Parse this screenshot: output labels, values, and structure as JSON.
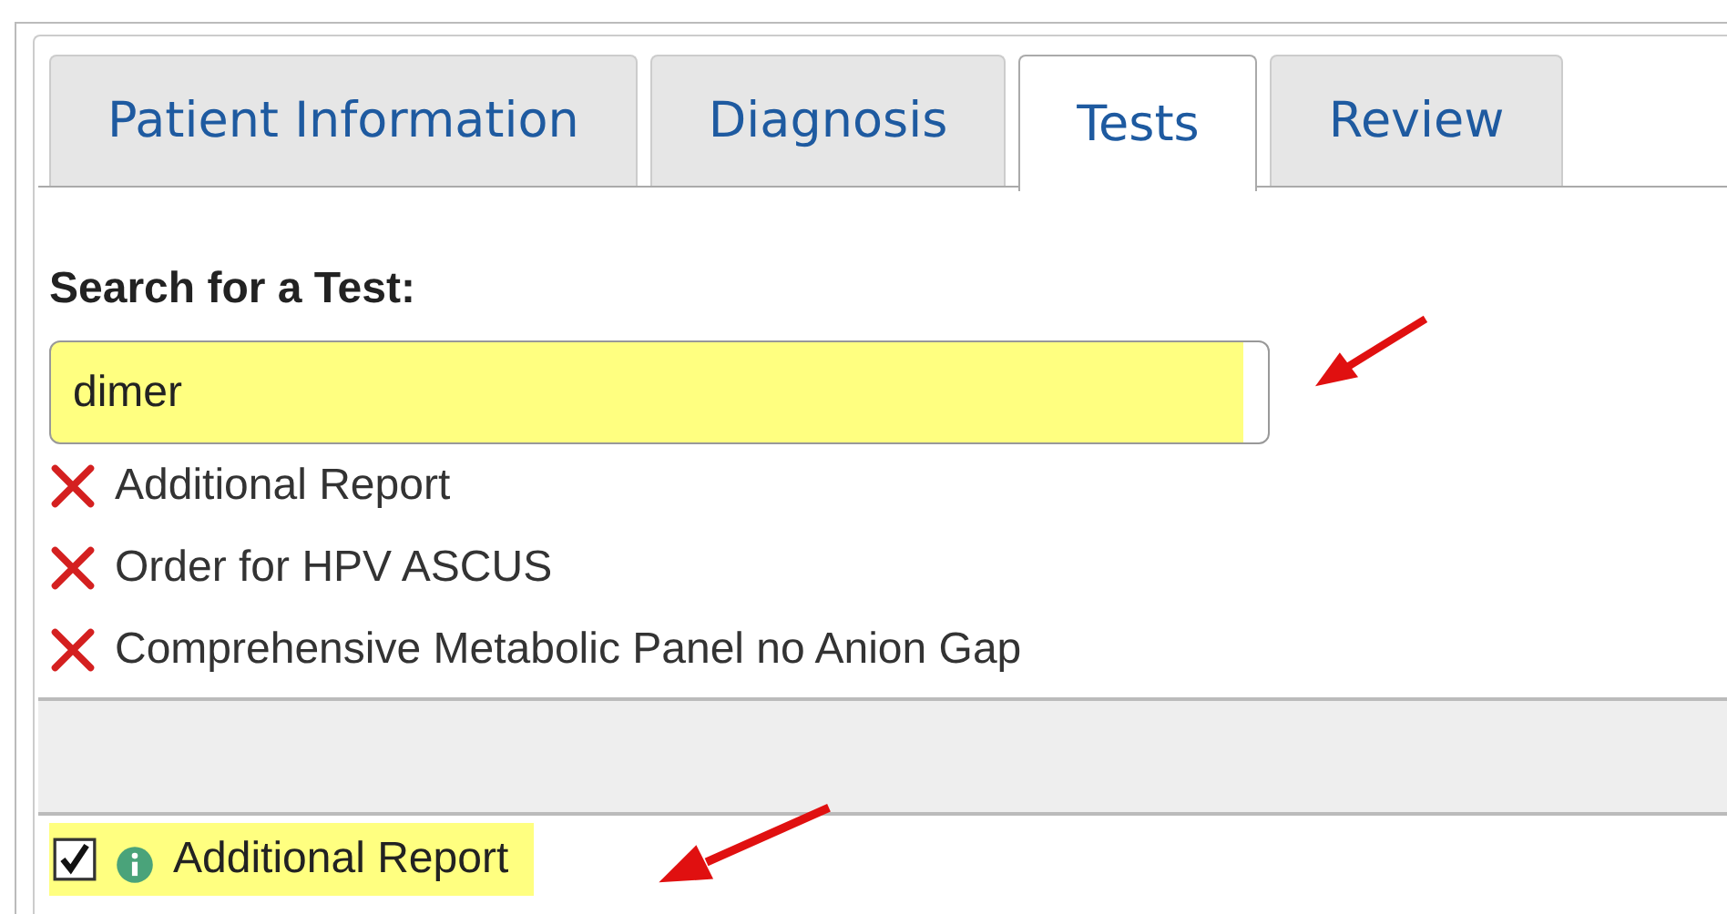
{
  "tabs": [
    {
      "label": "Patient Information",
      "selected": false
    },
    {
      "label": "Diagnosis",
      "selected": false
    },
    {
      "label": "Tests",
      "selected": true
    },
    {
      "label": "Review",
      "selected": false
    }
  ],
  "search": {
    "label": "Search for a Test:",
    "value": "dimer",
    "highlighted": true
  },
  "results": [
    {
      "label": "Additional Report"
    },
    {
      "label": "Order for HPV ASCUS"
    },
    {
      "label": "Comprehensive Metabolic Panel no Anion Gap"
    }
  ],
  "selected_tests": [
    {
      "label": "Additional Report",
      "checked": true,
      "highlighted": true
    }
  ]
}
